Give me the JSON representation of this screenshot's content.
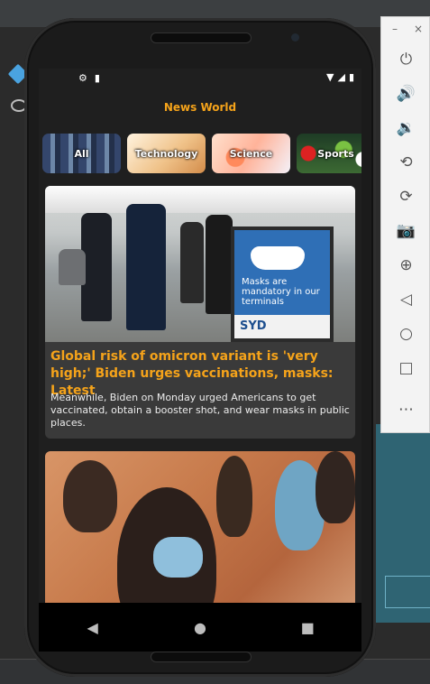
{
  "app": {
    "title": "News World"
  },
  "categories": [
    {
      "label": "All"
    },
    {
      "label": "Technology"
    },
    {
      "label": "Science"
    },
    {
      "label": "Sports"
    }
  ],
  "articles": [
    {
      "headline": "Global risk of omicron variant is 'very high;' Biden urges vaccinations, masks: Latest",
      "summary": "Meanwhile, Biden on Monday urged Americans to get vaccinated, obtain a booster shot, and wear masks in public places.",
      "image_sign_text": "Masks are mandatory in our terminals",
      "image_sign_code": "SYD"
    },
    {
      "headline": "",
      "summary": ""
    }
  ],
  "status_bar": {
    "left_icons": [
      "settings-icon",
      "sd-card-icon"
    ],
    "right_icons": [
      "wifi-icon",
      "signal-icon",
      "battery-icon"
    ]
  },
  "nav_bar": {
    "icons": [
      "back-icon",
      "home-icon",
      "recents-icon"
    ]
  },
  "emulator_toolbar": {
    "window_controls": [
      "minimize",
      "close"
    ],
    "tools": [
      "power-icon",
      "volume-up-icon",
      "volume-down-icon",
      "rotate-left-icon",
      "rotate-right-icon",
      "camera-icon",
      "zoom-icon",
      "back-icon",
      "home-icon",
      "overview-icon",
      "more-icon"
    ]
  },
  "colors": {
    "accent": "#f5a31a",
    "app_background": "#1f1f1f",
    "card_background": "#3a3a3a"
  }
}
